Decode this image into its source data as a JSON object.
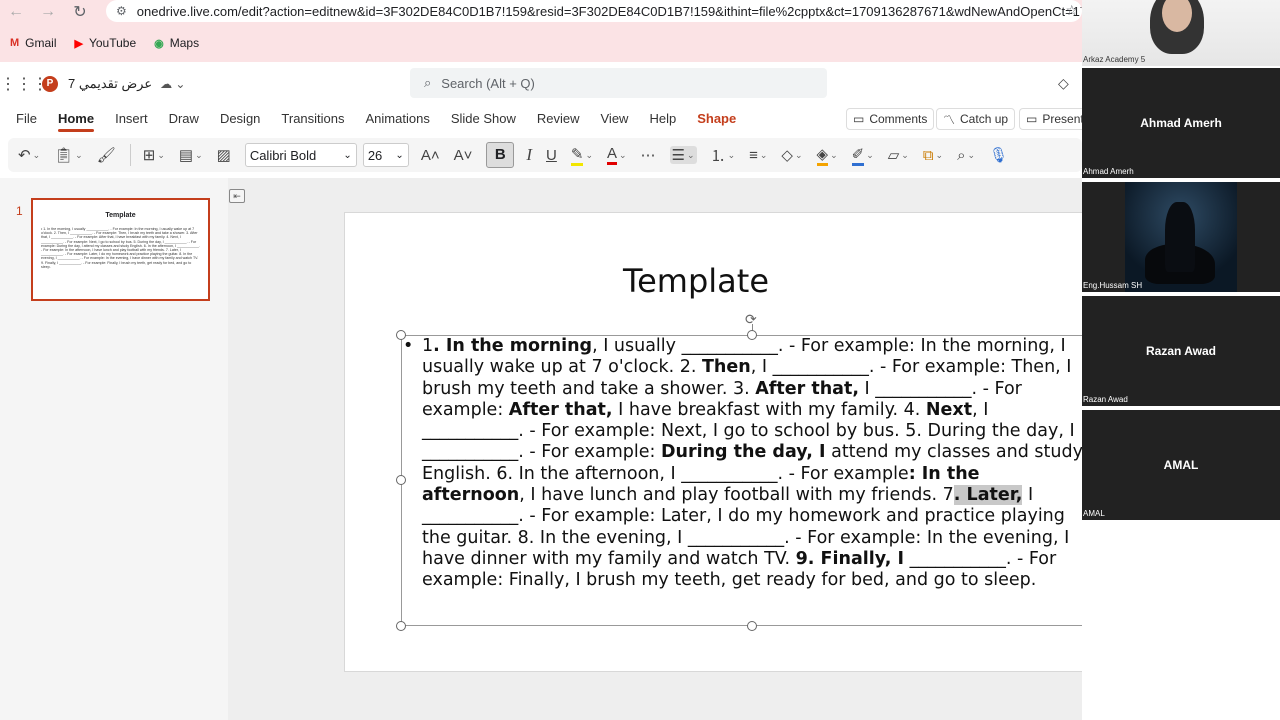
{
  "browser": {
    "url": "onedrive.live.com/edit?action=editnew&id=3F302DE84C0D1B7!159&resid=3F302DE84C0D1B7!159&ithint=file%2cpptx&ct=1709136287671&wdNewAndOpenCt=17...",
    "bookmarks": [
      {
        "label": "Gmail",
        "icon": "gmail-icon",
        "color": "#d93025"
      },
      {
        "label": "YouTube",
        "icon": "youtube-icon",
        "color": "#ff0000"
      },
      {
        "label": "Maps",
        "icon": "maps-icon",
        "color": "#34a853"
      }
    ]
  },
  "app": {
    "doc_title": "عرض تقديمي 7",
    "search_placeholder": "Search (Alt + Q)",
    "accent": "#c43e1c"
  },
  "tabs": [
    "File",
    "Home",
    "Insert",
    "Draw",
    "Design",
    "Transitions",
    "Animations",
    "Slide Show",
    "Review",
    "View",
    "Help",
    "Shape"
  ],
  "ribbon_buttons": {
    "comments": "Comments",
    "catch_up": "Catch up",
    "present": "Present"
  },
  "toolbar": {
    "font": "Calibri Bold",
    "size": "26"
  },
  "thumbnail": {
    "number": "1",
    "title": "Template",
    "text": "• 1. In the morning, I usually ___________. - For example: In the morning, I usually wake up at 7 o'clock. 2. Then, I ___________. - For example: Then, I brush my teeth and take a shower. 3. After that, I ___________. - For example: After that, I have breakfast with my family. 4. Next, I ___________. - For example: Next, I go to school by bus. 5. During the day, I ___________. - For example: During the day, I attend my classes and study English. 6. In the afternoon, I ___________. - For example: In the afternoon, I have lunch and play football with my friends. 7. Later, I ___________. - For example: Later, I do my homework and practice playing the guitar. 8. In the evening, I ___________. - For example: In the evening, I have dinner with my family and watch TV. 9. Finally, I ___________. - For example: Finally, I brush my teeth, get ready for bed, and go to sleep."
  },
  "slide": {
    "title": "Template",
    "segments": [
      {
        "t": "1",
        "b": false
      },
      {
        "t": ". In the morning",
        "b": true
      },
      {
        "t": ", I usually ___________. - For example: In the morning, I usually wake up at 7 o'clock. 2. ",
        "b": false
      },
      {
        "t": "Then",
        "b": true
      },
      {
        "t": ", I ___________. - For example: Then, I brush my teeth and take a shower. 3. ",
        "b": false
      },
      {
        "t": "After that,",
        "b": true
      },
      {
        "t": " I ___________. - For example: ",
        "b": false
      },
      {
        "t": "After that,",
        "b": true
      },
      {
        "t": " I have breakfast with my family. 4. ",
        "b": false
      },
      {
        "t": "Next",
        "b": true
      },
      {
        "t": ", I ___________. - For example: Next, I go to school by bus. 5. During the day, I ___________. - For example: ",
        "b": false
      },
      {
        "t": "During the day, I",
        "b": true
      },
      {
        "t": " attend my classes and study English. 6. In the afternoon, I ___________. - For example",
        "b": false
      },
      {
        "t": ": In the afternoon",
        "b": true
      },
      {
        "t": ", I have lunch and play football with my friends. 7",
        "b": false
      },
      {
        "t": ". Later,",
        "b": true,
        "hl": true
      },
      {
        "t": " I ___________. - For example: Later, I do my homework and practice playing the guitar. 8. In the evening, I ___________. - For example: In the evening, I have dinner with my family and watch TV. ",
        "b": false
      },
      {
        "t": "9. Finally, I",
        "b": true
      },
      {
        "t": " ___________. - For example: Finally, I brush my teeth, get ready for bed, and go to sleep.",
        "b": false
      }
    ]
  },
  "participants": [
    {
      "caption": "Arkaz Academy 5",
      "name": ""
    },
    {
      "caption": "Ahmad Amerh",
      "name": "Ahmad Amerh"
    },
    {
      "caption": "Eng.Hussam SH",
      "name": ""
    },
    {
      "caption": "Razan Awad",
      "name": "Razan Awad"
    },
    {
      "caption": "AMAL",
      "name": "AMAL"
    }
  ]
}
